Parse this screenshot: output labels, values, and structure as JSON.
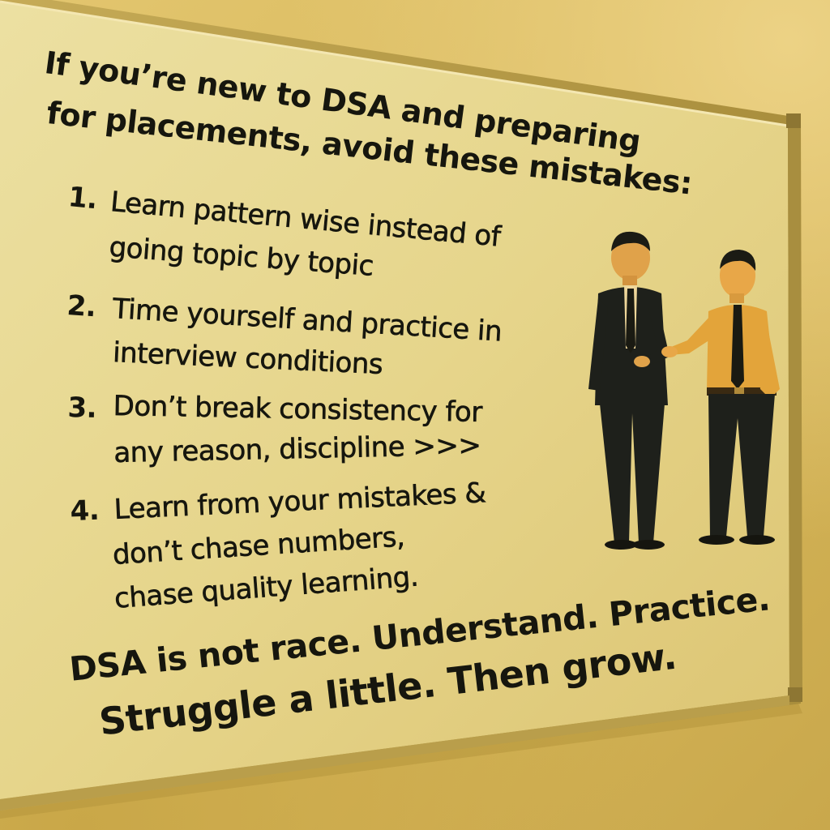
{
  "poster": {
    "intro_lines": [
      "If you’re new to DSA and preparing",
      "for placements, avoid these mistakes:"
    ],
    "items": [
      {
        "number": "1.",
        "lines": [
          "Learn pattern wise instead of",
          "going topic by topic"
        ]
      },
      {
        "number": "2.",
        "lines": [
          "Time yourself and practice in",
          "interview conditions"
        ]
      },
      {
        "number": "3.",
        "lines": [
          "Don’t break consistency for",
          "any reason, discipline >>>"
        ]
      },
      {
        "number": "4.",
        "lines": [
          "Learn from your mistakes &",
          "don’t chase numbers,",
          "chase quality learning."
        ]
      }
    ],
    "closing_lines": [
      "DSA is not race. Understand. Practice.",
      "Struggle a little. Then grow."
    ]
  },
  "illustration": {
    "subject": "two-men-talking",
    "icons": [
      "man-in-suit-icon",
      "man-in-orange-shirt-icon"
    ]
  },
  "colors": {
    "wall": "#d9b95a",
    "board": "#e8d488",
    "frame": "#bfa24c",
    "text": "#16160e",
    "suit": "#1d1f1a",
    "shirt": "#e3a43a"
  }
}
